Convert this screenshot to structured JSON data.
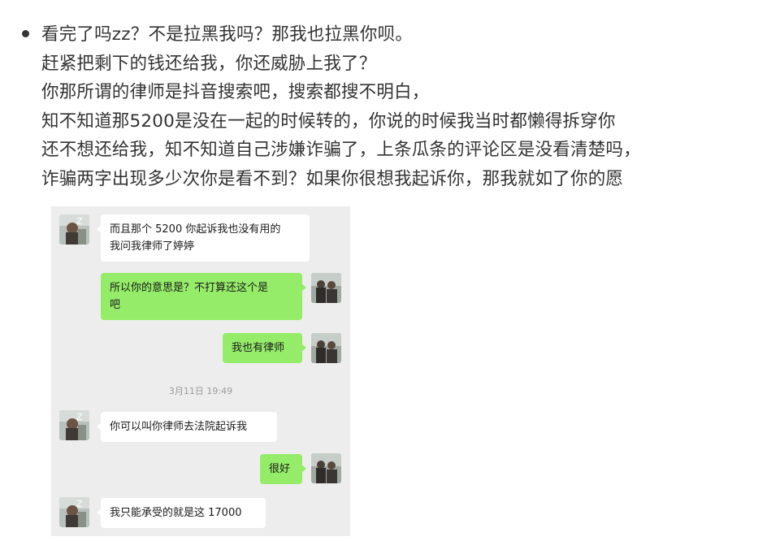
{
  "post": {
    "lines": [
      "看完了吗zz？不是拉黑我吗？那我也拉黑你呗。",
      "赶紧把剩下的钱还给我，你还威胁上我了？",
      "你那所谓的律师是抖音搜索吧，搜索都搜不明白，",
      "知不知道那5200是没在一起的时候转的，你说的时候我当时都懒得拆穿你",
      "还不想还给我，知不知道自己涉嫌诈骗了，上条瓜条的评论区是没看清楚吗，",
      "诈骗两字出现多少次你是看不到？如果你很想我起诉你，那我就如了你的愿"
    ]
  },
  "chat": {
    "messages": [
      {
        "side": "in",
        "text": "而且那个 5200 你起诉我也没有用的\n我问我律师了婷婷"
      },
      {
        "side": "out",
        "text": "所以你的意思是？不打算还这个是\n吧"
      },
      {
        "side": "out",
        "text": "我也有律师"
      },
      {
        "side": "in",
        "text": "你可以叫你律师去法院起诉我"
      },
      {
        "side": "out",
        "text": "很好"
      },
      {
        "side": "in",
        "text": "我只能承受的就是这 17000"
      }
    ],
    "timestamp": "3月11日 19:49"
  },
  "colors": {
    "chat_background": "#ededed",
    "incoming_bubble": "#ffffff",
    "outgoing_bubble": "#95ec69",
    "text": "#333333"
  }
}
